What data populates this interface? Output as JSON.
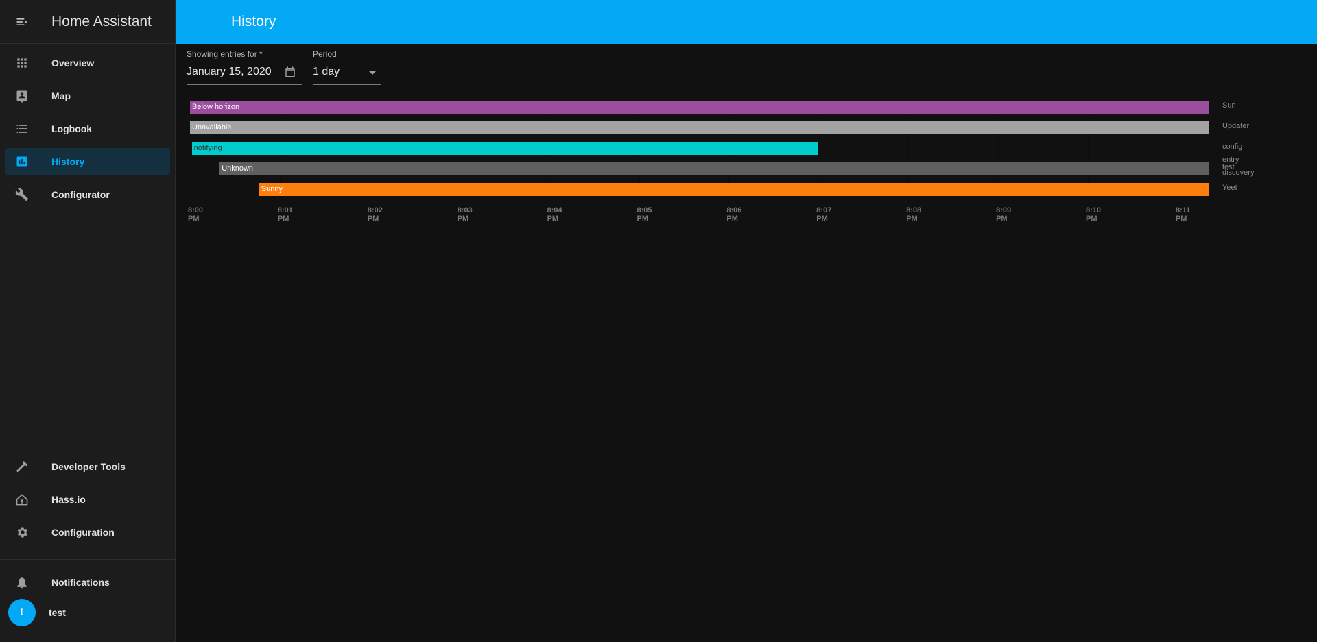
{
  "app": {
    "title": "Home Assistant"
  },
  "sidebar": {
    "items": [
      {
        "label": "Overview",
        "icon": "grid-icon"
      },
      {
        "label": "Map",
        "icon": "map-icon"
      },
      {
        "label": "Logbook",
        "icon": "logbook-icon"
      },
      {
        "label": "History",
        "icon": "history-chart-icon",
        "active": true
      },
      {
        "label": "Configurator",
        "icon": "wrench-icon"
      }
    ],
    "bottom_items": [
      {
        "label": "Developer Tools",
        "icon": "hammer-icon"
      },
      {
        "label": "Hass.io",
        "icon": "home-assistant-icon"
      },
      {
        "label": "Configuration",
        "icon": "gear-icon"
      }
    ],
    "notifications": {
      "label": "Notifications",
      "icon": "bell-icon"
    },
    "user": {
      "name": "test",
      "avatar_letter": "t"
    }
  },
  "topbar": {
    "title": "History"
  },
  "controls": {
    "date": {
      "label": "Showing entries for *",
      "value": "January 15, 2020",
      "icon": "calendar-icon"
    },
    "period": {
      "label": "Period",
      "value": "1 day",
      "icon": "dropdown-arrow-icon"
    }
  },
  "colors": {
    "accent": "#03a9f4",
    "sidebar_bg": "#1c1c1c",
    "page_bg": "#111111"
  },
  "chart_data": {
    "type": "timeline",
    "x_ticks": [
      "8:00 PM",
      "8:01 PM",
      "8:02 PM",
      "8:03 PM",
      "8:04 PM",
      "8:05 PM",
      "8:06 PM",
      "8:07 PM",
      "8:08 PM",
      "8:09 PM",
      "8:10 PM",
      "8:11 PM"
    ],
    "x_range_minutes": [
      0,
      11.35
    ],
    "rows": [
      {
        "entity": "Sun",
        "segments": [
          {
            "state": "Below horizon",
            "start": 0.0,
            "end": 11.35,
            "color": "#9b4d9e"
          }
        ]
      },
      {
        "entity": "Updater",
        "segments": [
          {
            "state": "Unavailable",
            "start": 0.0,
            "end": 11.35,
            "color": "#a3a3a3"
          }
        ]
      },
      {
        "entity": "config entry discovery",
        "segments": [
          {
            "state": "notifying",
            "start": 0.02,
            "end": 7.0,
            "color": "#00cccc",
            "text_color": "#333333"
          }
        ]
      },
      {
        "entity": "test",
        "segments": [
          {
            "state": "Unknown",
            "start": 0.33,
            "end": 11.35,
            "color": "#5f5f5f"
          }
        ]
      },
      {
        "entity": "Yeet",
        "segments": [
          {
            "state": "Sunny",
            "start": 0.77,
            "end": 11.35,
            "color": "#ff7f0e"
          }
        ]
      }
    ]
  }
}
